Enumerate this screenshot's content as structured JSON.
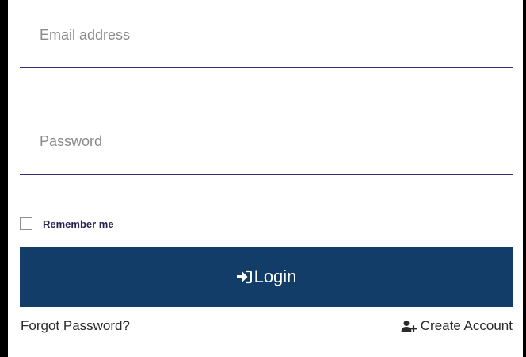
{
  "form": {
    "email": {
      "placeholder": "Email address",
      "value": ""
    },
    "password": {
      "placeholder": "Password",
      "value": ""
    },
    "remember_me": {
      "label": "Remember me",
      "checked": false
    },
    "login_button": {
      "label": "Login",
      "icon": "sign-in-icon"
    },
    "forgot_password": {
      "label": "Forgot Password?"
    },
    "create_account": {
      "label": "Create Account",
      "icon": "user-plus-icon"
    }
  },
  "colors": {
    "button_bg": "#123d68",
    "underline": "#3a2a7a",
    "label_dark": "#2a2250",
    "frame": "#000000"
  }
}
